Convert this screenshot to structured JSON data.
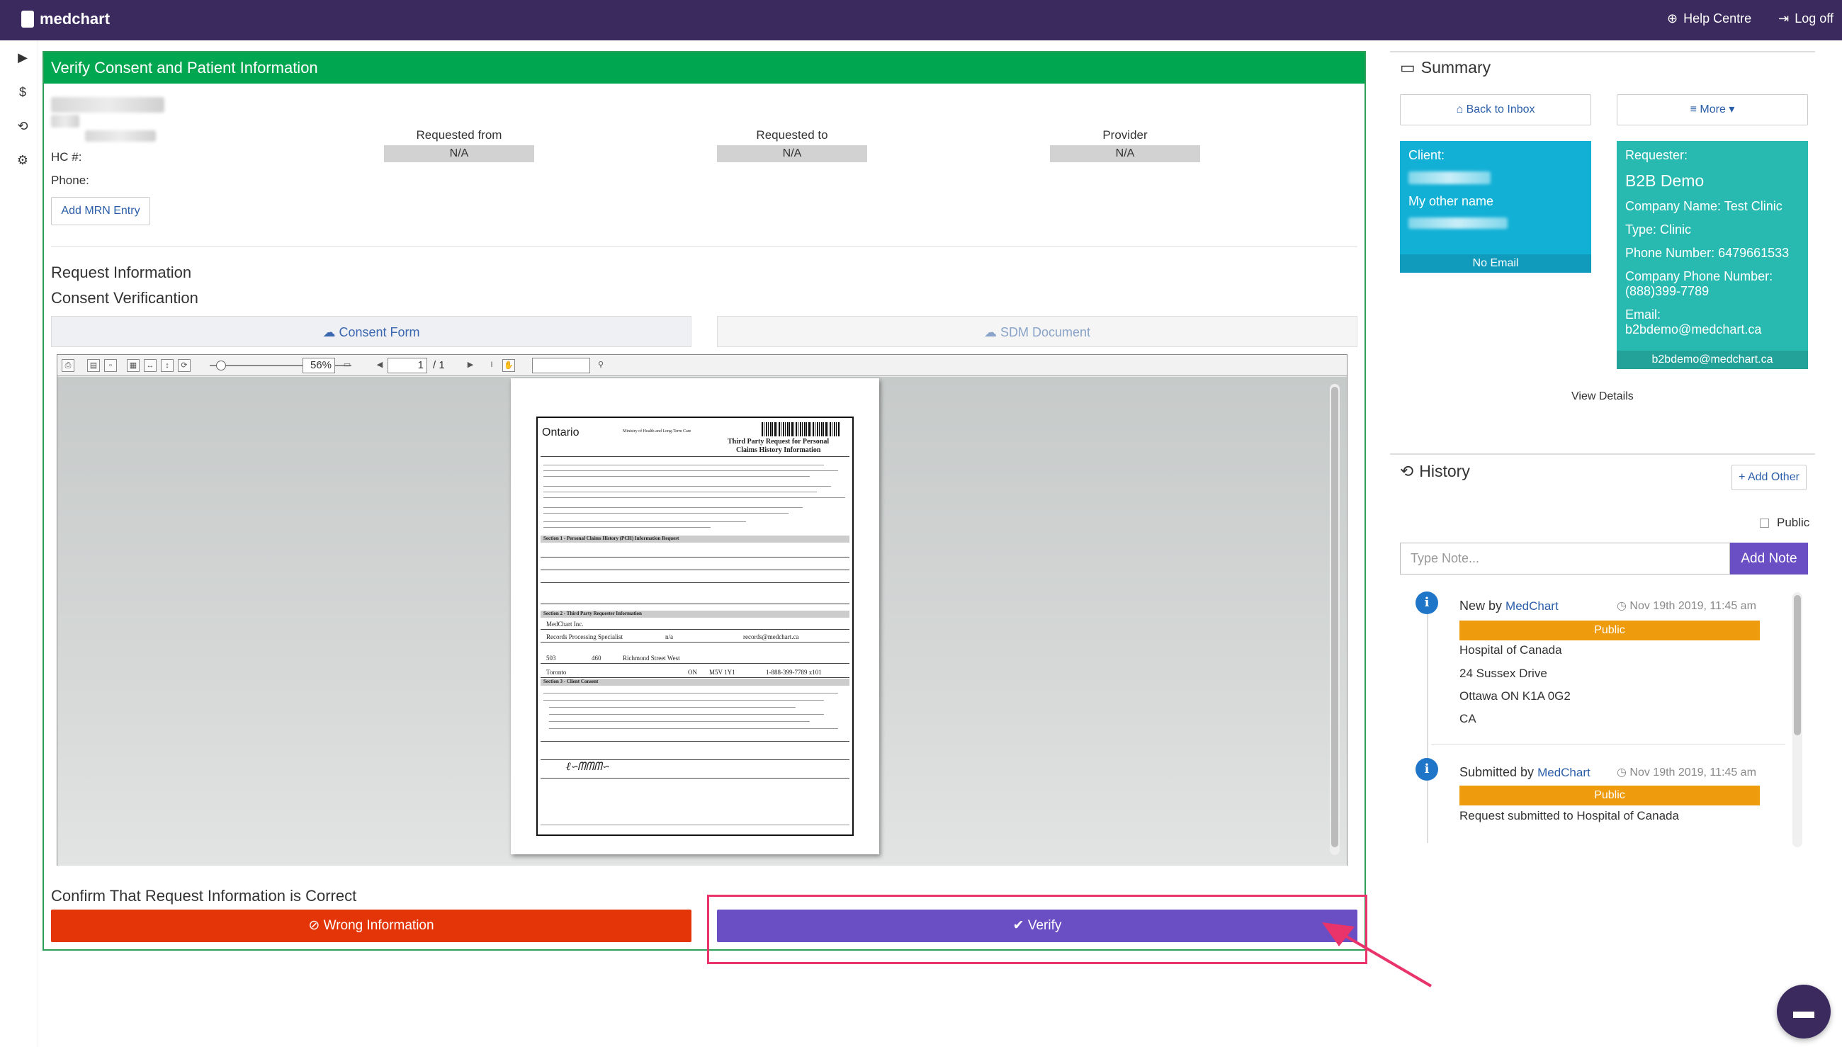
{
  "app": {
    "brand": "medchart"
  },
  "topbar": {
    "help": "Help Centre",
    "logoff": "Log off"
  },
  "rail": {
    "play": "▶",
    "dollar": "$",
    "history": "⟲",
    "settings": "⚙"
  },
  "main": {
    "header": "Verify Consent and Patient Information",
    "hc_label": "HC #:",
    "phone_label": "Phone:",
    "add_mrn": "Add MRN Entry",
    "meta": [
      {
        "title": "Requested from",
        "value": "N/A"
      },
      {
        "title": "Requested to",
        "value": "N/A"
      },
      {
        "title": "Provider",
        "value": "N/A"
      }
    ],
    "request_info": "Request Information",
    "consent_verification": "Consent Verificantion",
    "tab_consent": "☁ Consent Form",
    "tab_sdm": "☁ SDM Document",
    "confirm": "Confirm That Request Information is Correct",
    "wrong_btn": "⊘ Wrong Information",
    "verify_btn": "✔ Verify"
  },
  "viewer": {
    "zoom": "56%",
    "page": "1",
    "page_total": "/ 1"
  },
  "pdf": {
    "ontario": "Ontario",
    "ministry": "Ministry of Health and Long-Term Care",
    "title1": "Third Party Request for Personal",
    "title2": "Claims History Information",
    "s1": "Section 1 - Personal Claims History (PCH) Information Request",
    "s2": "Section 2 - Third Party Requester Information",
    "s3": "Section 3 - Client Consent",
    "requester": "MedChart Inc.",
    "contact": "Records Processing Specialist",
    "na": "n/a",
    "email": "records@medchart.ca",
    "unit": "503",
    "street_no": "460",
    "street": "Richmond Street West",
    "city": "Toronto",
    "province": "ON",
    "postal": "M5V 1Y1",
    "phone": "1-888-399-7789 x101"
  },
  "summary": {
    "title": "Summary",
    "back": "⌂ Back to Inbox",
    "more": "≡ More ▾",
    "client_label": "Client:",
    "client_other": "My other name",
    "client_email": "No Email",
    "requester_label": "Requester:",
    "requester_name": "B2B Demo",
    "company": "Company Name: Test Clinic",
    "type": "Type: Clinic",
    "phone": "Phone Number: 6479661533",
    "company_phone": "Company Phone Number: (888)399-7789",
    "email_label": "Email:",
    "email": "b2bdemo@medchart.ca",
    "email_foot": "b2bdemo@medchart.ca",
    "view_details": "View Details"
  },
  "history": {
    "title": "History",
    "add_other": "+ Add Other",
    "public_label": "Public",
    "note_placeholder": "Type Note...",
    "add_note": "Add Note",
    "items": [
      {
        "title": "New by",
        "by": "MedChart",
        "time": "◷ Nov 19th 2019, 11:45 am",
        "badge": "Public",
        "lines": [
          "Hospital of Canada",
          "24 Sussex Drive",
          "Ottawa ON K1A 0G2",
          "CA"
        ]
      },
      {
        "title": "Submitted by",
        "by": "MedChart",
        "time": "◷ Nov 19th 2019, 11:45 am",
        "badge": "Public",
        "lines": [
          "Request submitted to Hospital of Canada"
        ]
      }
    ]
  },
  "colors": {
    "topbar": "#3b2a5e",
    "header_green": "#00a650",
    "verify": "#6a4ec3",
    "wrong": "#e33507",
    "client_card": "#13b0d6",
    "requester_card": "#28b9b0",
    "badge": "#ee9b0d",
    "highlight": "#e8336b"
  }
}
